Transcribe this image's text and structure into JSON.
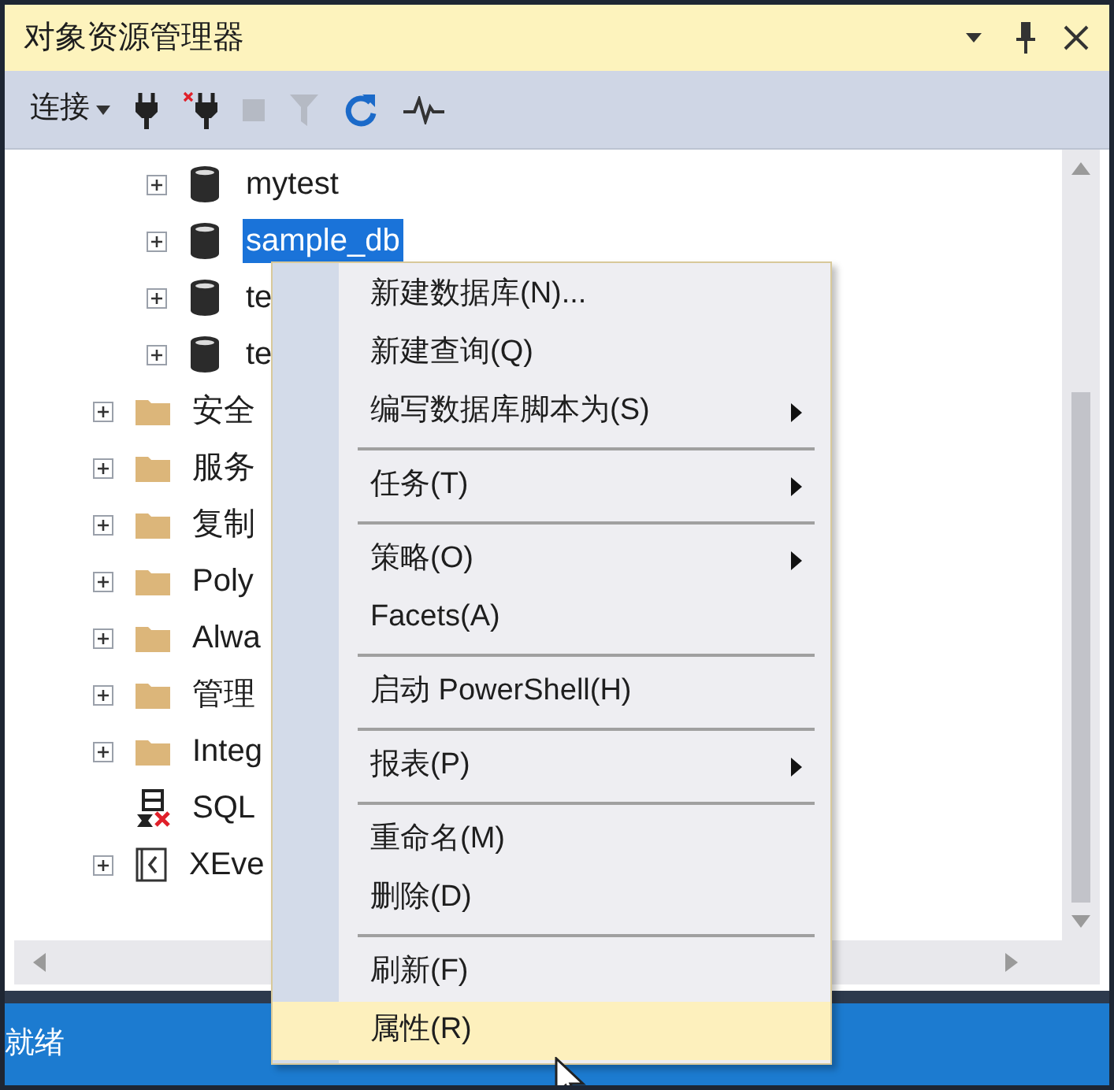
{
  "window": {
    "title": "对象资源管理器"
  },
  "toolbar": {
    "connect_label": "连接"
  },
  "tree": {
    "database_nodes": [
      {
        "label": "mytest",
        "selected": false
      },
      {
        "label": "sample_db",
        "selected": true
      },
      {
        "label": "te",
        "selected": false
      },
      {
        "label": "te",
        "selected": false
      }
    ],
    "server_nodes": [
      {
        "kind": "folder",
        "label": "安全"
      },
      {
        "kind": "folder",
        "label": "服务"
      },
      {
        "kind": "folder",
        "label": "复制"
      },
      {
        "kind": "folder",
        "label": "Poly"
      },
      {
        "kind": "folder",
        "label": "Alwa"
      },
      {
        "kind": "folder",
        "label": "管理"
      },
      {
        "kind": "folder",
        "label": "Integ"
      },
      {
        "kind": "agent",
        "label": "SQL"
      },
      {
        "kind": "xevent",
        "label": "XEve"
      }
    ]
  },
  "context_menu": [
    {
      "kind": "item",
      "label": "新建数据库(N)...",
      "submenu": false,
      "highlighted": false
    },
    {
      "kind": "item",
      "label": "新建查询(Q)",
      "submenu": false,
      "highlighted": false
    },
    {
      "kind": "item",
      "label": "编写数据库脚本为(S)",
      "submenu": true,
      "highlighted": false
    },
    {
      "kind": "separator"
    },
    {
      "kind": "item",
      "label": "任务(T)",
      "submenu": true,
      "highlighted": false
    },
    {
      "kind": "separator"
    },
    {
      "kind": "item",
      "label": "策略(O)",
      "submenu": true,
      "highlighted": false
    },
    {
      "kind": "item",
      "label": "Facets(A)",
      "submenu": false,
      "highlighted": false
    },
    {
      "kind": "separator"
    },
    {
      "kind": "item",
      "label": "启动 PowerShell(H)",
      "submenu": false,
      "highlighted": false
    },
    {
      "kind": "separator"
    },
    {
      "kind": "item",
      "label": "报表(P)",
      "submenu": true,
      "highlighted": false
    },
    {
      "kind": "separator"
    },
    {
      "kind": "item",
      "label": "重命名(M)",
      "submenu": false,
      "highlighted": false
    },
    {
      "kind": "item",
      "label": "删除(D)",
      "submenu": false,
      "highlighted": false
    },
    {
      "kind": "separator"
    },
    {
      "kind": "item",
      "label": "刷新(F)",
      "submenu": false,
      "highlighted": false
    },
    {
      "kind": "item",
      "label": "属性(R)",
      "submenu": false,
      "highlighted": true
    }
  ],
  "status_bar": {
    "text": "就绪"
  }
}
